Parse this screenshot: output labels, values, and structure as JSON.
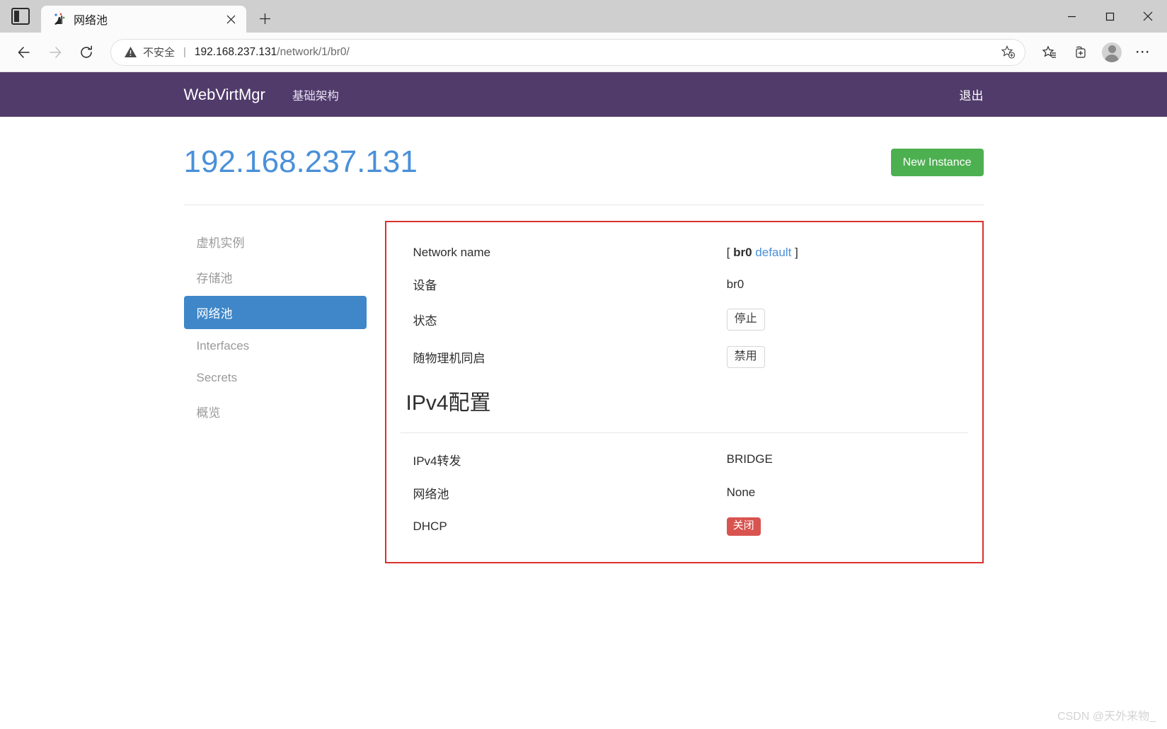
{
  "browser": {
    "tab": {
      "title": "网络池",
      "favicon_icon": "webvirtmgr-favicon",
      "close_icon": "close-icon"
    },
    "tab_list_icon": "tab-list-icon",
    "new_tab_icon": "new-tab-plus-icon",
    "window": {
      "minimize_icon": "minimize-icon",
      "maximize_icon": "maximize-icon",
      "close_icon": "window-close-icon"
    },
    "nav": {
      "back_icon": "back-arrow-icon",
      "forward_icon": "forward-arrow-icon",
      "reload_icon": "reload-icon"
    },
    "omnibox": {
      "warning_icon": "insecure-warning-icon",
      "security_label": "不安全",
      "separator": "|",
      "url_host": "192.168.237.131",
      "url_path": "/network/1/br0/",
      "add_favorite_icon": "add-favorite-star-icon"
    },
    "toolbar_icons": {
      "favorites": "favorites-star-list-icon",
      "collections": "collections-add-icon",
      "profile": "profile-avatar-icon",
      "settings_more": "more-options-icon"
    }
  },
  "navbar": {
    "brand": "WebVirtMgr",
    "links": [
      {
        "label": "基础架构",
        "name": "nav-link-infrastructure"
      }
    ],
    "logout_label": "退出",
    "background_color": "#513b6b"
  },
  "page": {
    "title": "192.168.237.131",
    "title_color": "#4a90d9",
    "new_instance_label": "New Instance",
    "new_instance_color": "#4cb050"
  },
  "sidebar": {
    "items": [
      {
        "label": "虚机实例",
        "name": "sidebar-item-instances",
        "active": false
      },
      {
        "label": "存储池",
        "name": "sidebar-item-storages",
        "active": false
      },
      {
        "label": "网络池",
        "name": "sidebar-item-networks",
        "active": true
      },
      {
        "label": "Interfaces",
        "name": "sidebar-item-interfaces",
        "active": false
      },
      {
        "label": "Secrets",
        "name": "sidebar-item-secrets",
        "active": false
      },
      {
        "label": "概览",
        "name": "sidebar-item-overview",
        "active": false
      }
    ],
    "active_color": "#3f87c9"
  },
  "detail": {
    "highlight_border_color": "#d9322c",
    "rows": [
      {
        "label": "Network name",
        "type": "network-name",
        "bracket_open": "[",
        "name": "br0",
        "tag": "default",
        "bracket_close": "]"
      },
      {
        "label": "设备",
        "type": "text",
        "value": "br0"
      },
      {
        "label": "状态",
        "type": "outline-button",
        "value": "停止"
      },
      {
        "label": "随物理机同启",
        "type": "outline-button",
        "value": "禁用"
      }
    ],
    "section_title": "IPv4配置",
    "ipv4_rows": [
      {
        "label": "IPv4转发",
        "type": "text",
        "value": "BRIDGE"
      },
      {
        "label": "网络池",
        "type": "text",
        "value": "None"
      },
      {
        "label": "DHCP",
        "type": "badge-danger",
        "value": "关闭"
      }
    ],
    "badge_danger_color": "#d9534f"
  },
  "watermark": "CSDN @天外来物_"
}
